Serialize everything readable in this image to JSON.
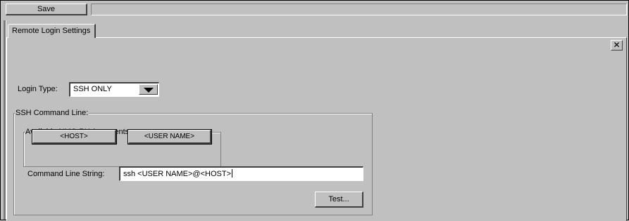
{
  "toolbar": {
    "save_label": "Save"
  },
  "tab": {
    "label": "Remote Login Settings"
  },
  "close_icon": "close-icon",
  "login": {
    "label": "Login Type:",
    "selected": "SSH ONLY"
  },
  "ssh_group": {
    "title": "SSH Command Line:",
    "args_group": {
      "title": "Available NMC-RX Arguments:",
      "host_button": "<HOST>",
      "user_button": "<USER NAME>"
    },
    "command_label": "Command Line String:",
    "command_value": "ssh <USER NAME>@<HOST>",
    "test_button": "Test..."
  }
}
